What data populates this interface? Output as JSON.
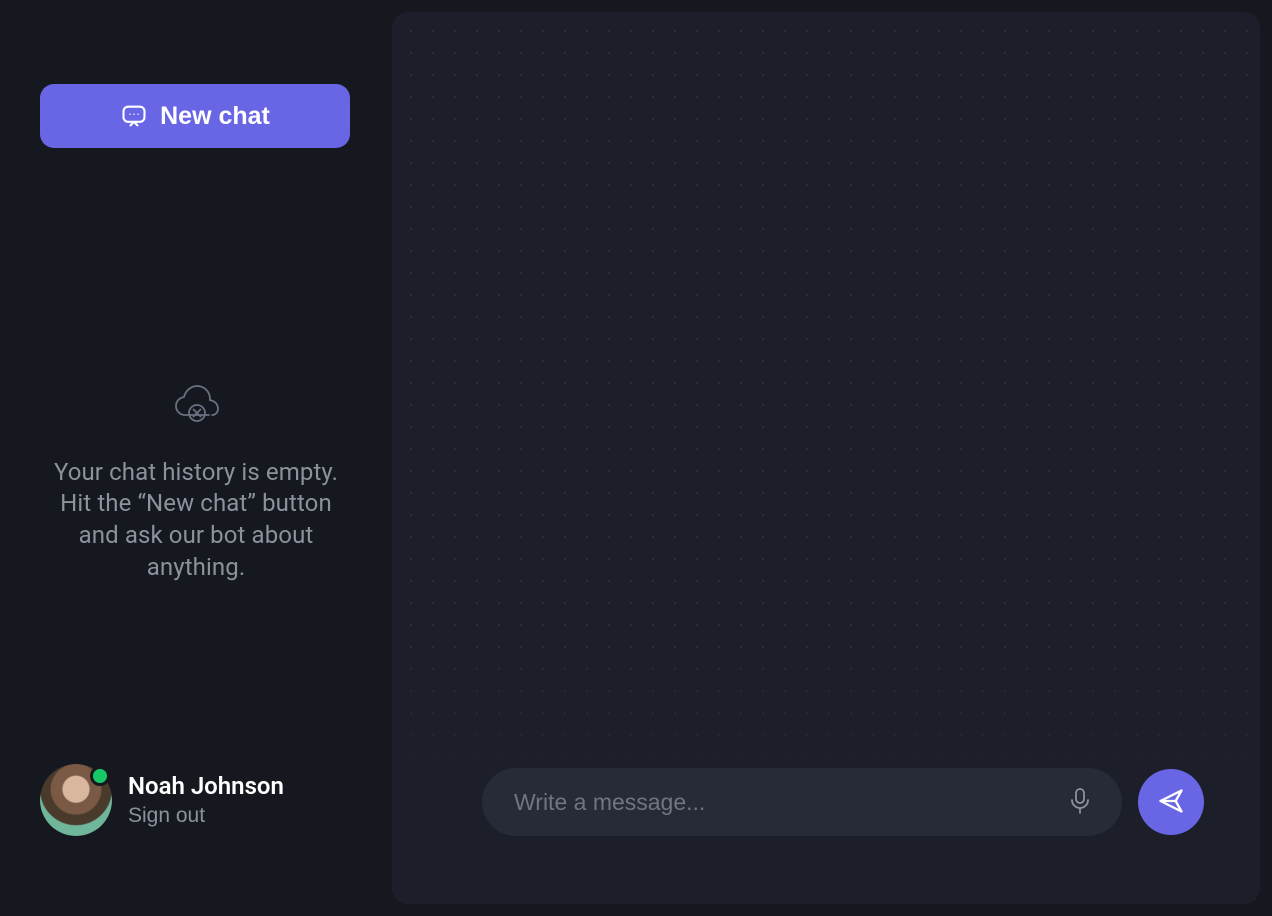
{
  "sidebar": {
    "new_chat_label": "New chat",
    "empty_message": "Your chat history is empty. Hit the “New chat” button and ask our bot about anything."
  },
  "user": {
    "name": "Noah Johnson",
    "signout_label": "Sign out",
    "presence": "online"
  },
  "composer": {
    "placeholder": "Write a message..."
  },
  "icons": {
    "new_chat": "chat-bubble-icon",
    "empty": "cloud-off-icon",
    "mic": "microphone-icon",
    "send": "paper-plane-icon",
    "presence": "presence-dot-icon"
  },
  "colors": {
    "accent": "#6966e5",
    "bg": "#15181f",
    "panel": "#1c1f2a",
    "input_bg": "#272b38",
    "text_muted": "#8c919c",
    "success": "#17c964"
  }
}
